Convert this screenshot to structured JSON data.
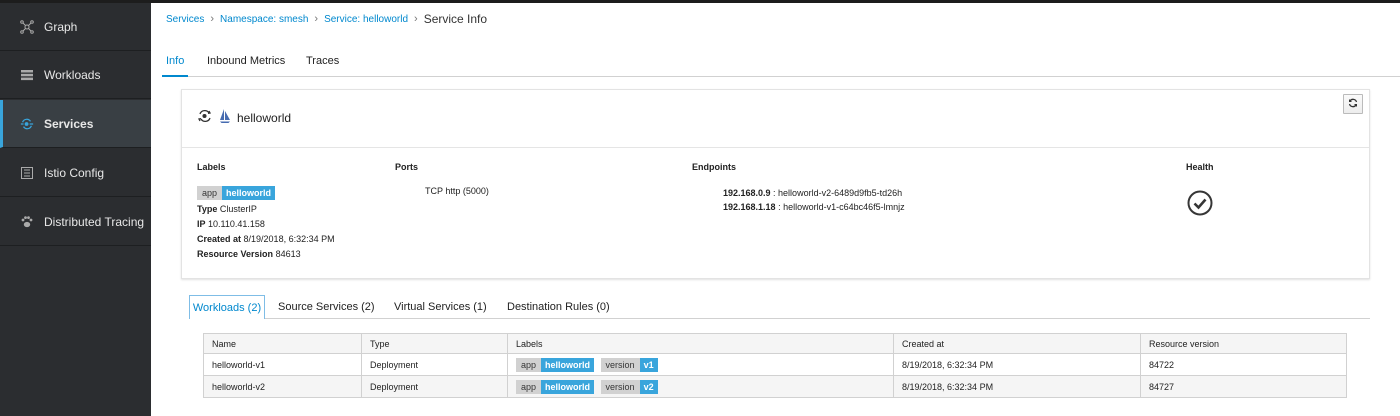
{
  "sidebar": {
    "items": [
      {
        "label": "Graph",
        "icon": "graph-icon",
        "active": false
      },
      {
        "label": "Workloads",
        "icon": "workloads-icon",
        "active": false
      },
      {
        "label": "Services",
        "icon": "services-icon",
        "active": true
      },
      {
        "label": "Istio Config",
        "icon": "istio-config-icon",
        "active": false
      },
      {
        "label": "Distributed Tracing",
        "icon": "paw-icon",
        "active": false
      }
    ]
  },
  "breadcrumb": {
    "services": "Services",
    "namespace": "Namespace: smesh",
    "service": "Service: helloworld",
    "current": "Service Info"
  },
  "tabs": [
    "Info",
    "Inbound Metrics",
    "Traces"
  ],
  "service": {
    "name": "helloworld",
    "headers": {
      "labels": "Labels",
      "ports": "Ports",
      "endpoints": "Endpoints",
      "health": "Health"
    },
    "label_key": "app",
    "label_value": "helloworld",
    "type_label": "Type",
    "type_value": "ClusterIP",
    "ip_label": "IP",
    "ip_value": "10.110.41.158",
    "created_label": "Created at",
    "created_value": "8/19/2018, 6:32:34 PM",
    "resver_label": "Resource Version",
    "resver_value": "84613",
    "port": "TCP http (5000)",
    "endpoints": [
      {
        "ip": "192.168.0.9",
        "name": " : helloworld-v2-6489d9fb5-td26h"
      },
      {
        "ip": "192.168.1.18",
        "name": " : helloworld-v1-c64bc46f5-lmnjz"
      }
    ]
  },
  "lower_tabs": [
    "Workloads (2)",
    "Source Services (2)",
    "Virtual Services (1)",
    "Destination Rules (0)"
  ],
  "workloads": {
    "columns": [
      "Name",
      "Type",
      "Labels",
      "Created at",
      "Resource version"
    ],
    "rows": [
      {
        "name": "helloworld-v1",
        "type": "Deployment",
        "app_key": "app",
        "app_val": "helloworld",
        "ver_key": "version",
        "ver_val": "v1",
        "created": "8/19/2018, 6:32:34 PM",
        "version": "84722"
      },
      {
        "name": "helloworld-v2",
        "type": "Deployment",
        "app_key": "app",
        "app_val": "helloworld",
        "ver_key": "version",
        "ver_val": "v2",
        "created": "8/19/2018, 6:32:34 PM",
        "version": "84727"
      }
    ]
  },
  "colors": {
    "accent": "#0088ce",
    "badge_value": "#39a5dc",
    "sidebar": "#2b2d30"
  }
}
